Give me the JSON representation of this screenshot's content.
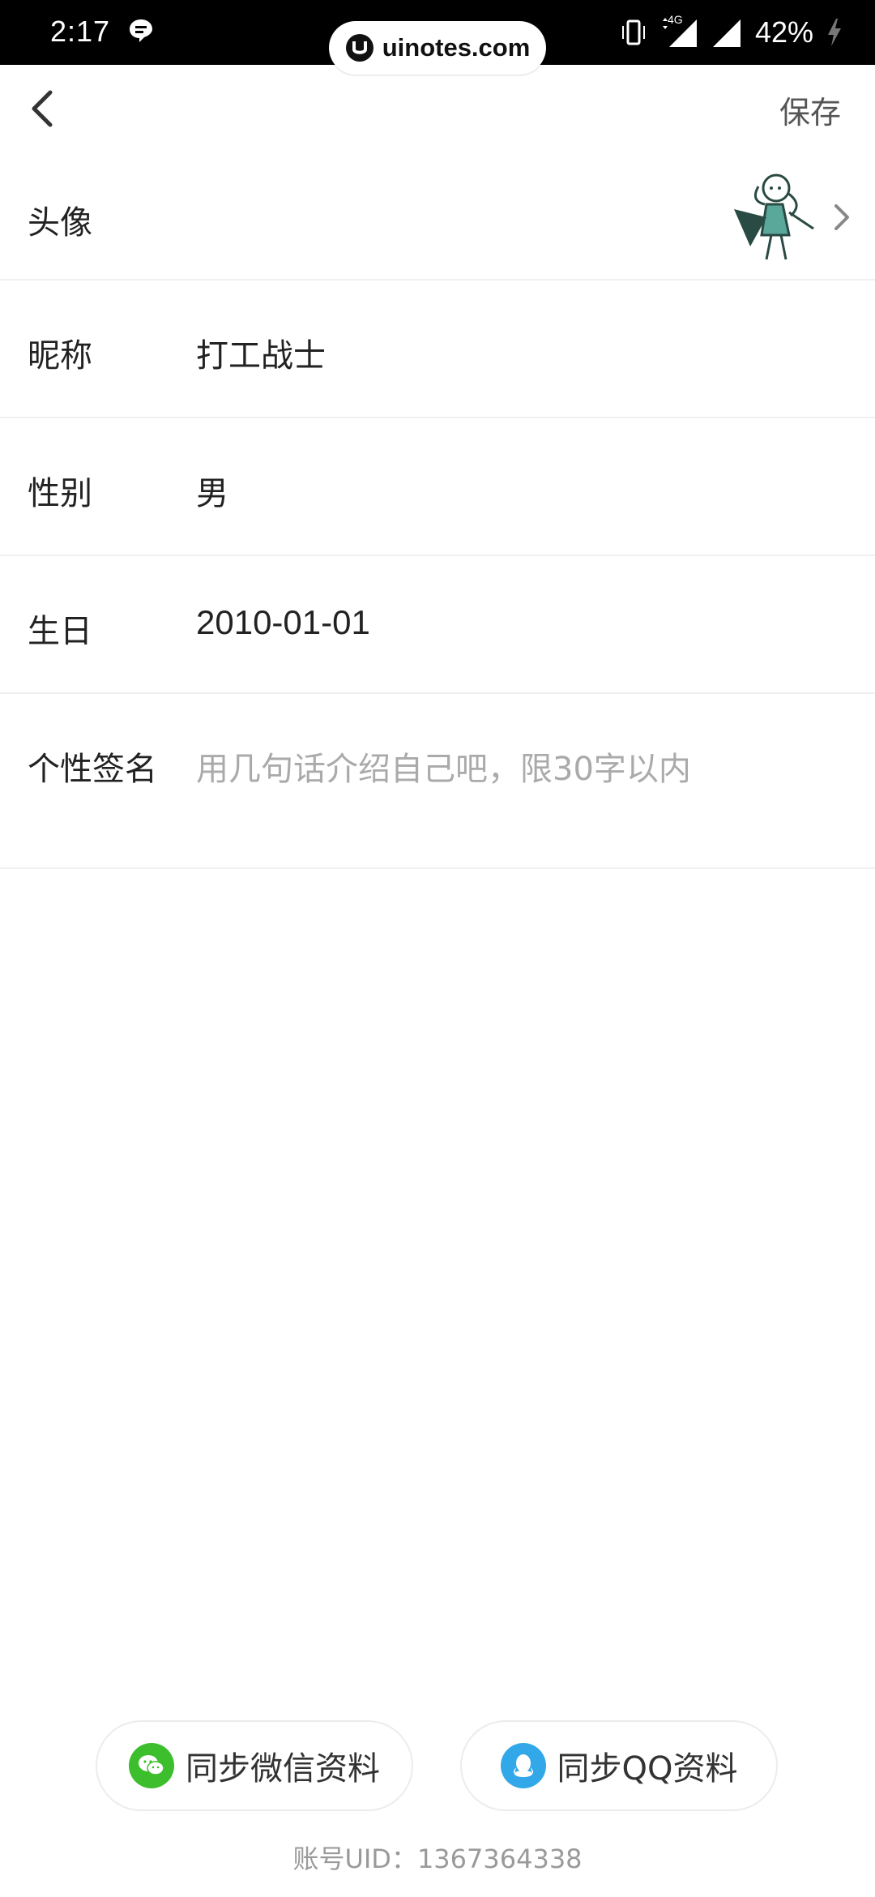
{
  "status_bar": {
    "time": "2:17",
    "battery": "42%",
    "network": "4G"
  },
  "watermark": {
    "text": "uinotes.com"
  },
  "header": {
    "save_label": "保存"
  },
  "profile": {
    "avatar_label": "头像",
    "nickname_label": "昵称",
    "nickname_value": "打工战士",
    "gender_label": "性别",
    "gender_value": "男",
    "birthday_label": "生日",
    "birthday_value": "2010-01-01",
    "signature_label": "个性签名",
    "signature_placeholder": "用几句话介绍自己吧，限30字以内"
  },
  "sync": {
    "wechat_label": "同步微信资料",
    "qq_label": "同步QQ资料"
  },
  "footer": {
    "uid_text": "账号UID：1367364338"
  },
  "colors": {
    "wechat": "#3dbe2c",
    "qq": "#32a8e8",
    "placeholder": "#aaaaaa",
    "divider": "#f0f0f0"
  }
}
